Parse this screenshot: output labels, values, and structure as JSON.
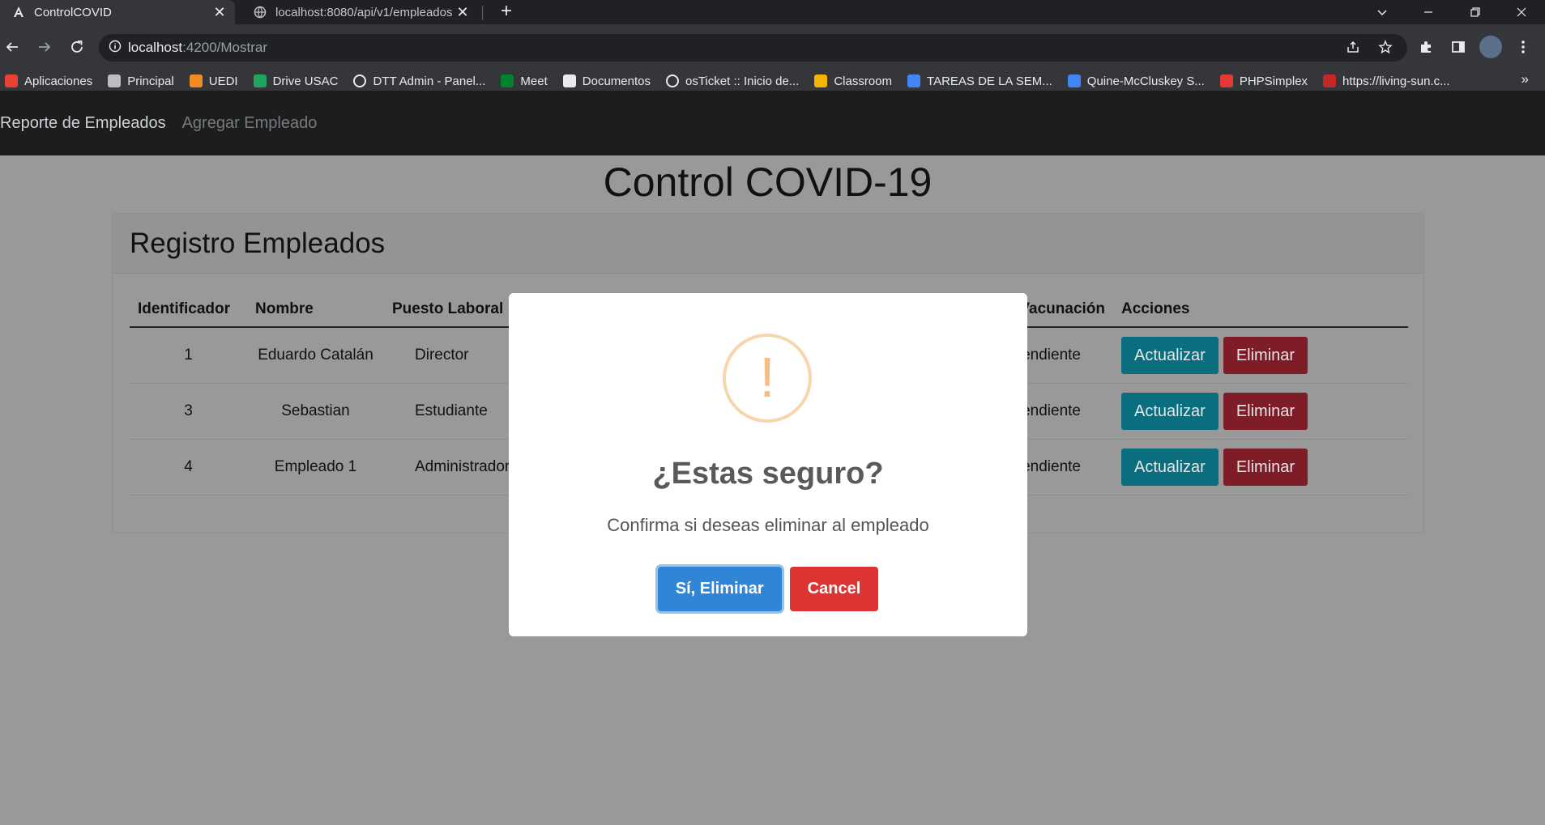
{
  "browser": {
    "tabs": [
      {
        "title": "ControlCOVID",
        "active": true,
        "icon": "angular-icon"
      },
      {
        "title": "localhost:8080/api/v1/empleados",
        "active": false,
        "icon": "globe-icon"
      }
    ],
    "url": {
      "host": "localhost",
      "path": ":4200/Mostrar"
    },
    "bookmarks": [
      {
        "label": "Aplicaciones",
        "icon": "apps-grid-icon",
        "color": "#ea4335"
      },
      {
        "label": "Principal",
        "icon": "site-icon",
        "color": "#bdbdbd"
      },
      {
        "label": "UEDI",
        "icon": "site-icon",
        "color": "#f28b25"
      },
      {
        "label": "Drive USAC",
        "icon": "drive-icon",
        "color": "#1fa463"
      },
      {
        "label": "DTT Admin - Panel...",
        "icon": "globe-icon",
        "color": "#e8eaed"
      },
      {
        "label": "Meet",
        "icon": "meet-icon",
        "color": "#00832d"
      },
      {
        "label": "Documentos",
        "icon": "site-icon",
        "color": "#e8eaed"
      },
      {
        "label": "osTicket :: Inicio de...",
        "icon": "globe-icon",
        "color": "#e8eaed"
      },
      {
        "label": "Classroom",
        "icon": "classroom-icon",
        "color": "#f4b400"
      },
      {
        "label": "TAREAS DE LA SEM...",
        "icon": "docs-icon",
        "color": "#4285f4"
      },
      {
        "label": "Quine-McCluskey S...",
        "icon": "site-icon",
        "color": "#4285f4"
      },
      {
        "label": "PHPSimplex",
        "icon": "calculator-icon",
        "color": "#e53935"
      },
      {
        "label": "https://living-sun.c...",
        "icon": "site-icon",
        "color": "#c62828"
      }
    ],
    "bookmarks_more": "»"
  },
  "nav": {
    "report": "Reporte de Empleados",
    "add": "Agregar Empleado"
  },
  "page": {
    "title": "Control COVID-19",
    "card_title": "Registro Empleados"
  },
  "table": {
    "headers": {
      "id": "Identificador",
      "name": "Nombre",
      "role": "Puesto Laboral",
      "vaccine": "stado de Vacunación",
      "actions": "Acciones"
    },
    "rows": [
      {
        "id": "1",
        "name": "Eduardo Catalán",
        "role": "Director",
        "vaccine": "Pendiente"
      },
      {
        "id": "3",
        "name": "Sebastian",
        "role": "Estudiante",
        "vaccine": "Pendiente"
      },
      {
        "id": "4",
        "name": "Empleado 1",
        "role": "Administrador",
        "vaccine": "Pendiente"
      }
    ],
    "update_label": "Actualizar",
    "delete_label": "Eliminar"
  },
  "modal": {
    "icon": "!",
    "title": "¿Estas seguro?",
    "text": "Confirma si deseas eliminar al empleado",
    "confirm": "Sí, Eliminar",
    "cancel": "Cancel"
  },
  "colors": {
    "confirm": "#3085d6",
    "cancel": "#dd3333",
    "warning": "#f8bb86"
  }
}
